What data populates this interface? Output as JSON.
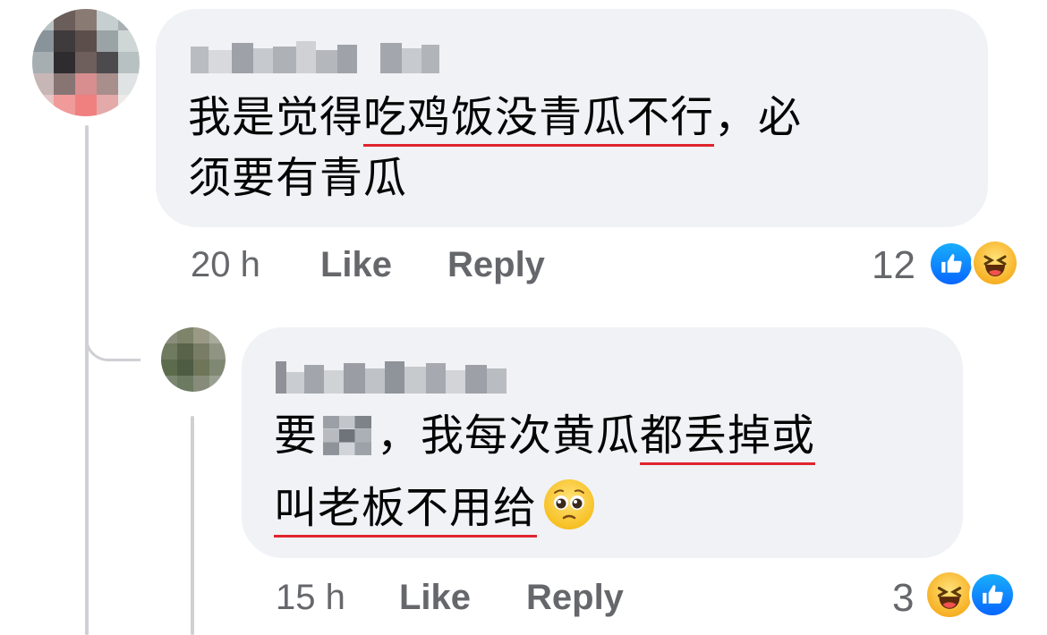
{
  "comments": [
    {
      "text_line1_plain": "我是觉得",
      "text_line1_underlined": "吃鸡饭没青瓜不行",
      "text_line1_tail": "，必",
      "text_line2": "须要有青瓜",
      "time": "20 h",
      "like_label": "Like",
      "reply_label": "Reply",
      "reaction_count": "12",
      "reactions": [
        "like-icon",
        "haha-icon"
      ]
    },
    {
      "text_line1_head": "要",
      "text_line1_mid": "，我每次黄瓜",
      "text_line1_underlined": "都丢掉或",
      "text_line2_underlined": "叫老板不用给",
      "emoji": "pleading-face-emoji",
      "time": "15 h",
      "like_label": "Like",
      "reply_label": "Reply",
      "reaction_count": "3",
      "reactions": [
        "haha-icon",
        "like-icon"
      ]
    }
  ],
  "colors": {
    "bubble": "#f0f2f5",
    "meta_text": "#65676b",
    "underline": "#e0242e",
    "like_blue": "#0866ff",
    "haha_yellow": "#f7b125"
  }
}
